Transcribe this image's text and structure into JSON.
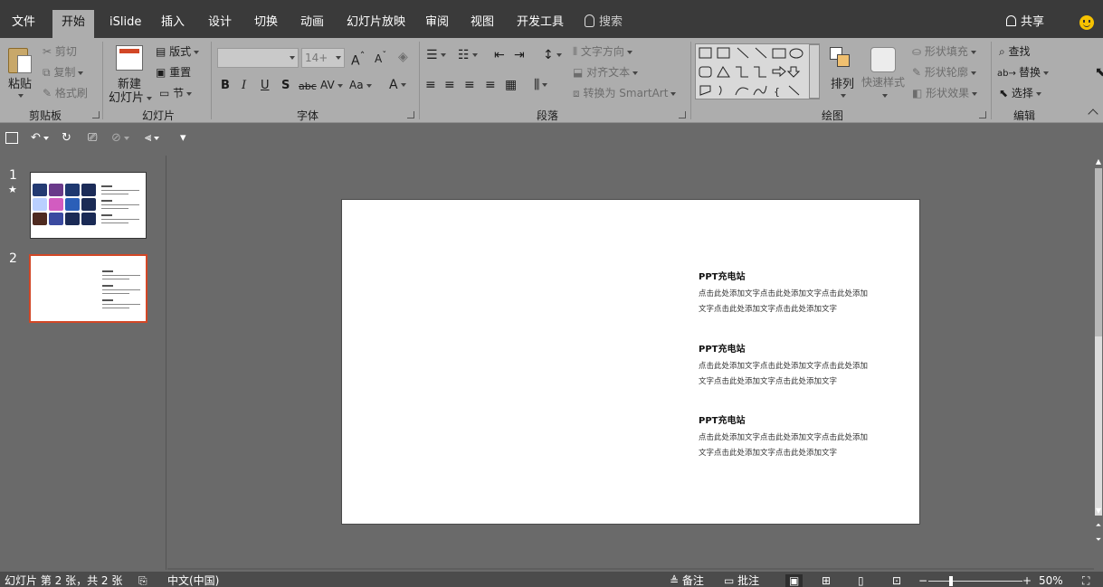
{
  "tabs": [
    "文件",
    "开始",
    "iSlide",
    "插入",
    "设计",
    "切换",
    "动画",
    "幻灯片放映",
    "审阅",
    "视图",
    "开发工具"
  ],
  "active_tab": "开始",
  "tell_me": "搜索",
  "share": "共享",
  "ribbon": {
    "clipboard": {
      "paste": "粘贴",
      "cut": "剪切",
      "copy": "复制",
      "format_painter": "格式刷",
      "label": "剪贴板"
    },
    "slides": {
      "new_slide_line1": "新建",
      "new_slide_line2": "幻灯片",
      "layout": "版式",
      "reset": "重置",
      "section": "节",
      "label": "幻灯片"
    },
    "font": {
      "size": "14+",
      "bold": "B",
      "italic": "I",
      "underline": "U",
      "shadow": "S",
      "strike": "abc",
      "spacing": "AV",
      "case": "Aa",
      "color": "A",
      "grow": "A",
      "shrink": "A",
      "label": "字体"
    },
    "paragraph": {
      "text_direction": "文字方向",
      "align_text": "对齐文本",
      "smartart": "转换为 SmartArt",
      "label": "段落"
    },
    "drawing": {
      "arrange": "排列",
      "quick_styles": "快速样式",
      "shape_fill": "形状填充",
      "shape_outline": "形状轮廓",
      "shape_effects": "形状效果",
      "label": "绘图"
    },
    "editing": {
      "find": "查找",
      "replace": "替换",
      "select": "选择",
      "label": "编辑"
    }
  },
  "thumbnails": [
    {
      "number": "1",
      "marker": "★"
    },
    {
      "number": "2",
      "marker": ""
    }
  ],
  "slide": {
    "blocks": [
      {
        "title": "PPT充电站",
        "line1": "点击此处添加文字点击此处添加文字点击此处添加",
        "line2": "文字点击此处添加文字点击此处添加文字"
      },
      {
        "title": "PPT充电站",
        "line1": "点击此处添加文字点击此处添加文字点击此处添加",
        "line2": "文字点击此处添加文字点击此处添加文字"
      },
      {
        "title": "PPT充电站",
        "line1": "点击此处添加文字点击此处添加文字点击此处添加",
        "line2": "文字点击此处添加文字点击此处添加文字"
      }
    ]
  },
  "status": {
    "slide_info": "幻灯片 第 2 张，共 2 张",
    "language": "中文(中国)",
    "notes": "备注",
    "comments": "批注",
    "zoom": "50%"
  }
}
